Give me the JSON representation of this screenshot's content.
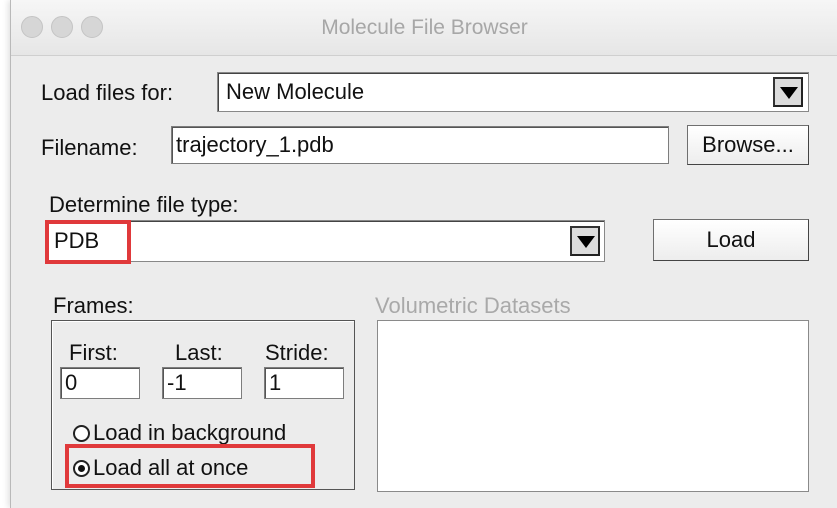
{
  "window": {
    "title": "Molecule File Browser"
  },
  "load_for": {
    "label": "Load files for:",
    "value": "New Molecule"
  },
  "filename": {
    "label": "Filename:",
    "value": "trajectory_1.pdb",
    "browse_label": "Browse..."
  },
  "file_type": {
    "label": "Determine file type:",
    "value": "PDB",
    "load_label": "Load"
  },
  "frames": {
    "label": "Frames:",
    "first_label": "First:",
    "first_value": "0",
    "last_label": "Last:",
    "last_value": "-1",
    "stride_label": "Stride:",
    "stride_value": "1",
    "options": [
      {
        "label": "Load in background",
        "checked": false
      },
      {
        "label": "Load all at once",
        "checked": true
      }
    ]
  },
  "volumetric": {
    "label": "Volumetric Datasets"
  },
  "colors": {
    "highlight": "#e0393b",
    "window_bg": "#ececec"
  }
}
